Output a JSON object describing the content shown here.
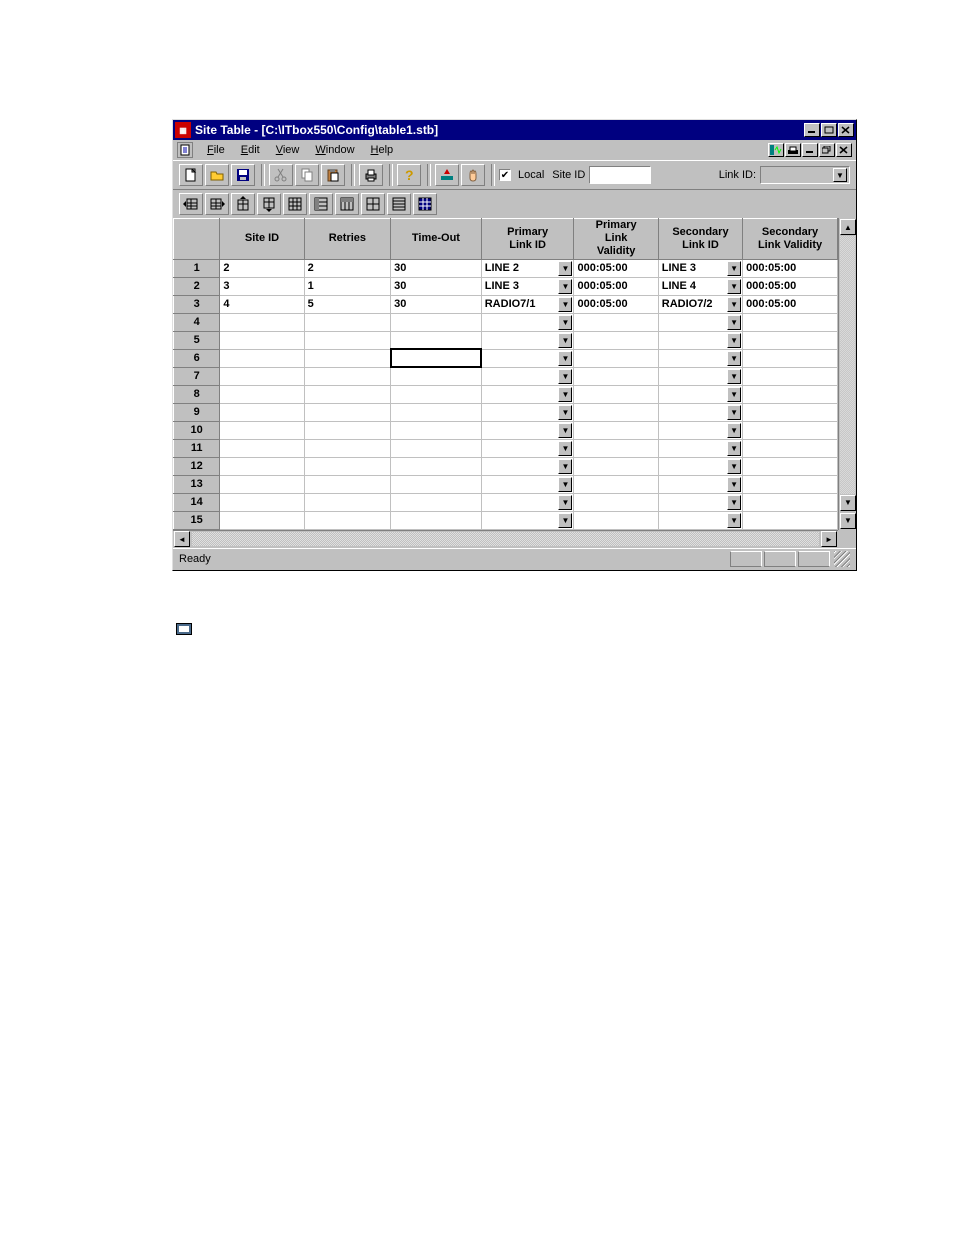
{
  "titlebar": {
    "title": "Site Table - [C:\\ITbox550\\Config\\table1.stb]"
  },
  "menubar": {
    "items": [
      {
        "label": "File",
        "underline": "F"
      },
      {
        "label": "Edit",
        "underline": "E"
      },
      {
        "label": "View",
        "underline": "V"
      },
      {
        "label": "Window",
        "underline": "W"
      },
      {
        "label": "Help",
        "underline": "H"
      }
    ]
  },
  "toolbar": {
    "local_label": "Local",
    "local_checked": true,
    "siteid_label": "Site ID",
    "siteid_value": "",
    "linkid_label": "Link ID:",
    "linkid_value": ""
  },
  "grid": {
    "columns": [
      "Site ID",
      "Retries",
      "Time-Out",
      "Primary\nLink ID",
      "Primary\nLink\nValidity",
      "Secondary\nLink ID",
      "Secondary\nLink Validity"
    ],
    "rows": [
      {
        "n": 1,
        "site_id": "2",
        "retries": "2",
        "timeout": "30",
        "plid": "LINE 2",
        "plv": "000:05:00",
        "slid": "LINE 3",
        "slv": "000:05:00"
      },
      {
        "n": 2,
        "site_id": "3",
        "retries": "1",
        "timeout": "30",
        "plid": "LINE 3",
        "plv": "000:05:00",
        "slid": "LINE 4",
        "slv": "000:05:00"
      },
      {
        "n": 3,
        "site_id": "4",
        "retries": "5",
        "timeout": "30",
        "plid": "RADIO7/1",
        "plv": "000:05:00",
        "slid": "RADIO7/2",
        "slv": "000:05:00"
      },
      {
        "n": 4,
        "site_id": "",
        "retries": "",
        "timeout": "",
        "plid": "",
        "plv": "",
        "slid": "",
        "slv": ""
      },
      {
        "n": 5,
        "site_id": "",
        "retries": "",
        "timeout": "",
        "plid": "",
        "plv": "",
        "slid": "",
        "slv": ""
      },
      {
        "n": 6,
        "site_id": "",
        "retries": "",
        "timeout": "",
        "plid": "",
        "plv": "",
        "slid": "",
        "slv": ""
      },
      {
        "n": 7,
        "site_id": "",
        "retries": "",
        "timeout": "",
        "plid": "",
        "plv": "",
        "slid": "",
        "slv": ""
      },
      {
        "n": 8,
        "site_id": "",
        "retries": "",
        "timeout": "",
        "plid": "",
        "plv": "",
        "slid": "",
        "slv": ""
      },
      {
        "n": 9,
        "site_id": "",
        "retries": "",
        "timeout": "",
        "plid": "",
        "plv": "",
        "slid": "",
        "slv": ""
      },
      {
        "n": 10,
        "site_id": "",
        "retries": "",
        "timeout": "",
        "plid": "",
        "plv": "",
        "slid": "",
        "slv": ""
      },
      {
        "n": 11,
        "site_id": "",
        "retries": "",
        "timeout": "",
        "plid": "",
        "plv": "",
        "slid": "",
        "slv": ""
      },
      {
        "n": 12,
        "site_id": "",
        "retries": "",
        "timeout": "",
        "plid": "",
        "plv": "",
        "slid": "",
        "slv": ""
      },
      {
        "n": 13,
        "site_id": "",
        "retries": "",
        "timeout": "",
        "plid": "",
        "plv": "",
        "slid": "",
        "slv": ""
      },
      {
        "n": 14,
        "site_id": "",
        "retries": "",
        "timeout": "",
        "plid": "",
        "plv": "",
        "slid": "",
        "slv": ""
      },
      {
        "n": 15,
        "site_id": "",
        "retries": "",
        "timeout": "",
        "plid": "",
        "plv": "",
        "slid": "",
        "slv": ""
      }
    ],
    "selected_cell": {
      "row": 6,
      "col": "timeout"
    }
  },
  "statusbar": {
    "text": "Ready"
  }
}
